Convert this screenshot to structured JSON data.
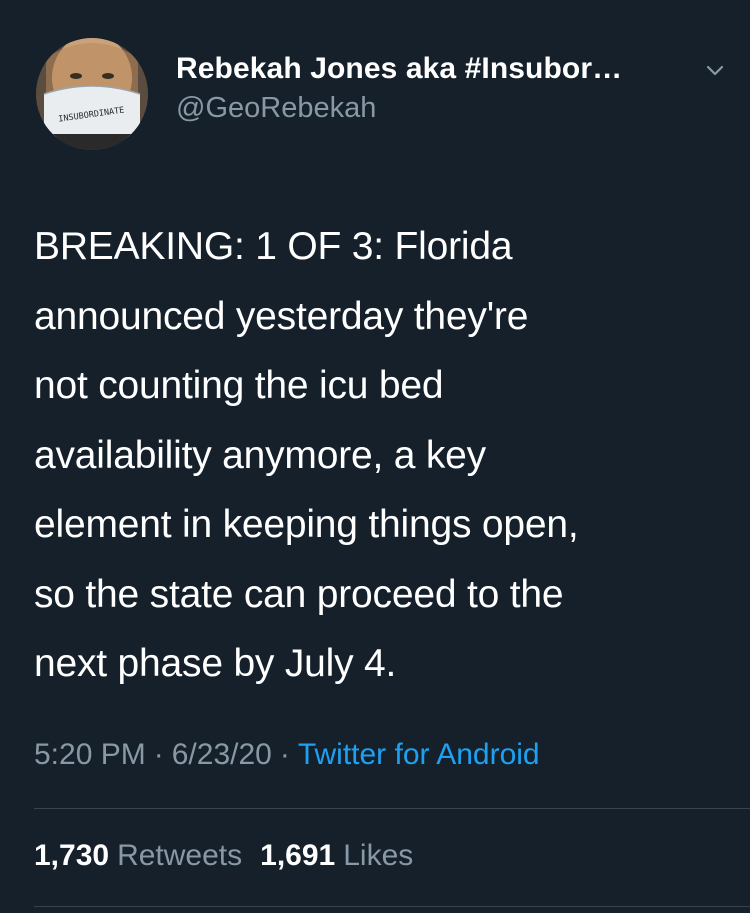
{
  "author": {
    "display_name": "Rebekah Jones aka #Insubor…",
    "handle": "@GeoRebekah",
    "avatar_mask_text": "INSUBORDINATE"
  },
  "tweet": {
    "text": "BREAKING: 1 OF 3: Florida\nannounced yesterday they're\nnot counting the icu bed\navailability anymore,  a key\nelement in keeping things open,\nso the state can proceed to the\nnext phase by July 4."
  },
  "meta": {
    "time": "5:20 PM",
    "separator": "·",
    "date": "6/23/20",
    "source": "Twitter for Android"
  },
  "stats": {
    "retweets_count": "1,730",
    "retweets_label": "Retweets",
    "likes_count": "1,691",
    "likes_label": "Likes"
  },
  "colors": {
    "background": "#15202b",
    "primary_text": "#ffffff",
    "secondary_text": "#8899a6",
    "accent": "#1da1f2",
    "divider": "#38444d"
  },
  "icons": {
    "menu": "chevron-down-icon"
  }
}
